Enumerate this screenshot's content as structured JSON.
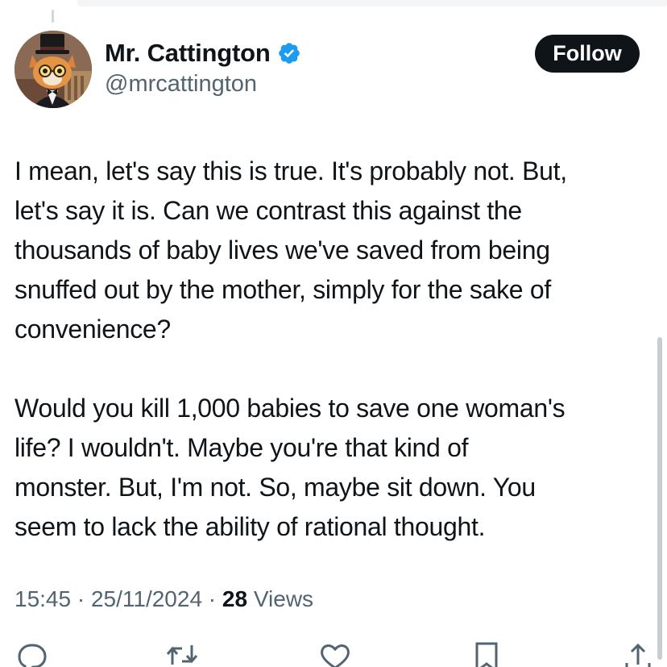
{
  "user": {
    "display_name": "Mr. Cattington",
    "handle": "@mrcattington",
    "verified": true
  },
  "follow_label": "Follow",
  "tweet": {
    "paragraphs": [
      [
        "I mean, let's say this is true. It's probably not. But,",
        "let's say it is. Can we contrast this against the",
        "thousands of baby lives we've saved from being",
        "snuffed out by the mother, simply for the sake of",
        "convenience?"
      ],
      [
        "Would you kill 1,000 babies to save one woman's",
        "life? I wouldn't. Maybe you're that kind of",
        "monster. But, I'm not. So, maybe sit down. You",
        "seem to lack the ability of rational thought."
      ]
    ]
  },
  "meta": {
    "time": "15:45",
    "separator": " · ",
    "date": "25/11/2024",
    "views_count": "28",
    "views_label": " Views"
  },
  "actions": [
    "reply-icon",
    "retweet-icon",
    "like-icon",
    "bookmark-icon",
    "share-icon"
  ],
  "colors": {
    "text": "#0f1419",
    "secondary": "#536471",
    "verified_blue": "#1d9bf0",
    "follow_bg": "#0f1419"
  }
}
